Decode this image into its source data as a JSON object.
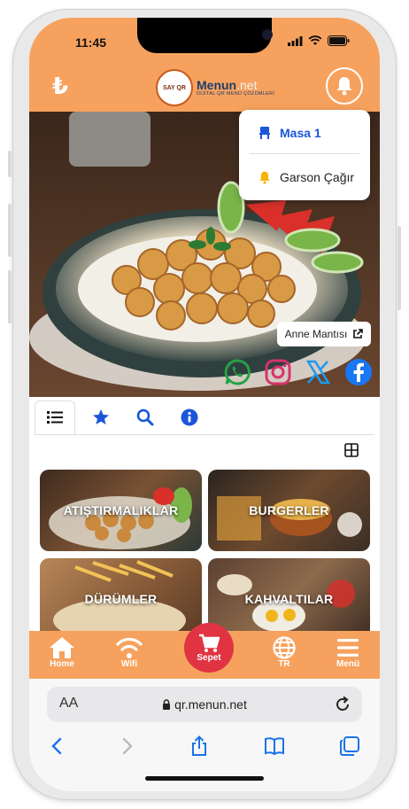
{
  "status_bar": {
    "time": "11:45"
  },
  "header": {
    "currency_symbol": "₺",
    "logo_badge": "SAY QR",
    "logo_name": "Menun",
    "logo_suffix": ".net",
    "logo_tagline": "DİJİTAL QR MENÜ ÇÖZÜMLERİ"
  },
  "dropdown": {
    "table_label": "Masa 1",
    "call_waiter_label": "Garson Çağır"
  },
  "hero": {
    "dish_tag": "Anne Mantısı"
  },
  "social": [
    "whatsapp-icon",
    "instagram-icon",
    "x-icon",
    "facebook-icon"
  ],
  "tabs": [
    "list-icon",
    "star-icon",
    "search-icon",
    "info-icon"
  ],
  "categories": [
    {
      "label": "ATIŞTIRMALIKLAR"
    },
    {
      "label": "BURGERLER"
    },
    {
      "label": "DÜRÜMLER"
    },
    {
      "label": "KAHVALTILAR"
    }
  ],
  "bottom_nav": {
    "home": "Home",
    "wifi": "Wifi",
    "cart": "Sepet",
    "language": "TR",
    "menu": "Menü"
  },
  "browser": {
    "text_size": "AA",
    "url": "qr.menun.net"
  },
  "colors": {
    "primary": "#f6a25e",
    "accent_blue": "#1a56db",
    "cart_red": "#e03442"
  }
}
